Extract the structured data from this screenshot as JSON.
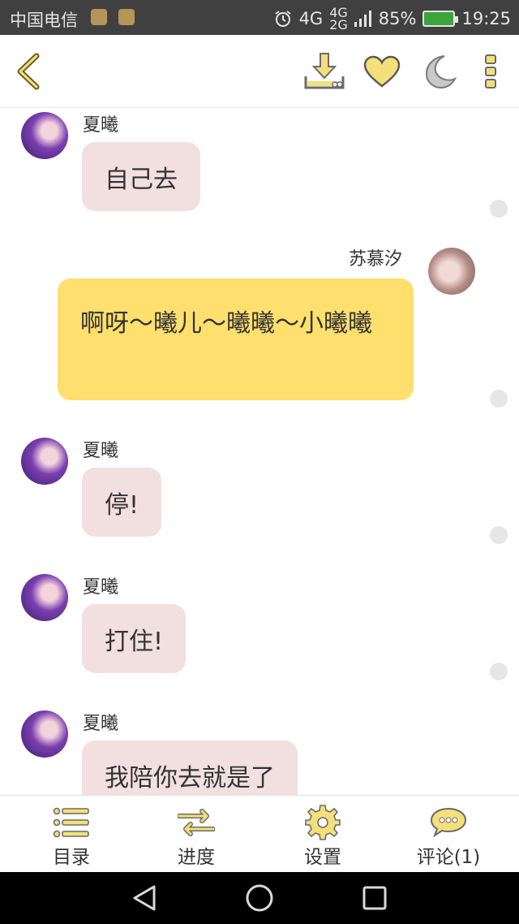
{
  "status_bar": {
    "carrier": "中国电信",
    "network": "4G",
    "network_small": "4G\n2G",
    "battery": "85%",
    "time": "19:25"
  },
  "toolbar": {
    "icons": [
      "back-chevron-icon",
      "download-icon",
      "heart-icon",
      "moon-icon",
      "more-vertical-icon"
    ],
    "accent": "#f3e07a"
  },
  "chat": {
    "messages": [
      {
        "side": "left",
        "name": "夏曦",
        "text": "自己去"
      },
      {
        "side": "right",
        "name": "苏慕汐",
        "text": "啊呀～曦儿～曦曦～小曦曦"
      },
      {
        "side": "left",
        "name": "夏曦",
        "text": "停!"
      },
      {
        "side": "left",
        "name": "夏曦",
        "text": "打住!"
      },
      {
        "side": "left",
        "name": "夏曦",
        "text": "我陪你去就是了"
      }
    ],
    "colors": {
      "left_bubble": "#f2e0e0",
      "right_bubble": "#ffdf6e"
    }
  },
  "bottom_nav": {
    "items": [
      {
        "label": "目录",
        "icon": "list-icon"
      },
      {
        "label": "进度",
        "icon": "swap-arrows-icon"
      },
      {
        "label": "设置",
        "icon": "gear-icon"
      },
      {
        "label": "评论(1)",
        "icon": "comment-icon"
      }
    ]
  },
  "system_nav": {
    "icons": [
      "back-triangle-icon",
      "home-circle-icon",
      "recents-square-icon"
    ]
  }
}
